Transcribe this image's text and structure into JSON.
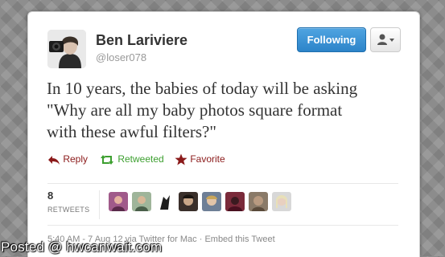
{
  "tweet": {
    "author_name": "Ben Lariviere",
    "author_handle": "@loser078",
    "text_lines": [
      "In 10 years, the babies of today will be asking",
      "\"Why are all my baby photos square format",
      "with these awful filters?\""
    ],
    "follow_button_label": "Following",
    "actions": {
      "reply_label": "Reply",
      "retweet_label": "Retweeted",
      "favorite_label": "Favorite"
    },
    "stats": {
      "retweet_count": "8",
      "retweet_label": "RETWEETS"
    },
    "meta": "5:40 AM - 7 Aug 12 via Twitter for Mac · Embed this Tweet",
    "retweeter_avatars": [
      {
        "name": "retweeter-avatar-1",
        "color": "#a05a8a"
      },
      {
        "name": "retweeter-avatar-2",
        "color": "#6f8a6a"
      },
      {
        "name": "retweeter-avatar-3",
        "color": "#2a2a2a"
      },
      {
        "name": "retweeter-avatar-4",
        "color": "#3a2f2a"
      },
      {
        "name": "retweeter-avatar-5",
        "color": "#6e7f96"
      },
      {
        "name": "retweeter-avatar-6",
        "color": "#7a2a3a"
      },
      {
        "name": "retweeter-avatar-7",
        "color": "#8a7a68"
      },
      {
        "name": "retweeter-avatar-8",
        "color": "#9a9a9a"
      }
    ]
  },
  "colors": {
    "follow_button": "#2c84c9",
    "reply": "#8b1a1a",
    "retweet": "#3c9f2f",
    "favorite": "#8b1a1a"
  },
  "watermark": "Posted @ hwcanwait.com"
}
